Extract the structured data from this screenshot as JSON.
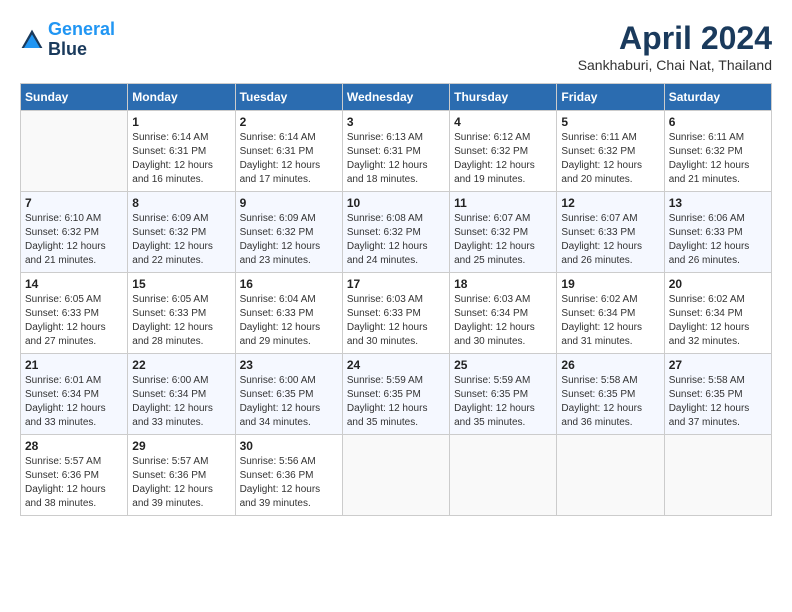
{
  "header": {
    "logo_line1": "General",
    "logo_line2": "Blue",
    "month_title": "April 2024",
    "location": "Sankhaburi, Chai Nat, Thailand"
  },
  "days_of_week": [
    "Sunday",
    "Monday",
    "Tuesday",
    "Wednesday",
    "Thursday",
    "Friday",
    "Saturday"
  ],
  "weeks": [
    [
      {
        "num": "",
        "sunrise": "",
        "sunset": "",
        "daylight": ""
      },
      {
        "num": "1",
        "sunrise": "Sunrise: 6:14 AM",
        "sunset": "Sunset: 6:31 PM",
        "daylight": "Daylight: 12 hours and 16 minutes."
      },
      {
        "num": "2",
        "sunrise": "Sunrise: 6:14 AM",
        "sunset": "Sunset: 6:31 PM",
        "daylight": "Daylight: 12 hours and 17 minutes."
      },
      {
        "num": "3",
        "sunrise": "Sunrise: 6:13 AM",
        "sunset": "Sunset: 6:31 PM",
        "daylight": "Daylight: 12 hours and 18 minutes."
      },
      {
        "num": "4",
        "sunrise": "Sunrise: 6:12 AM",
        "sunset": "Sunset: 6:32 PM",
        "daylight": "Daylight: 12 hours and 19 minutes."
      },
      {
        "num": "5",
        "sunrise": "Sunrise: 6:11 AM",
        "sunset": "Sunset: 6:32 PM",
        "daylight": "Daylight: 12 hours and 20 minutes."
      },
      {
        "num": "6",
        "sunrise": "Sunrise: 6:11 AM",
        "sunset": "Sunset: 6:32 PM",
        "daylight": "Daylight: 12 hours and 21 minutes."
      }
    ],
    [
      {
        "num": "7",
        "sunrise": "Sunrise: 6:10 AM",
        "sunset": "Sunset: 6:32 PM",
        "daylight": "Daylight: 12 hours and 21 minutes."
      },
      {
        "num": "8",
        "sunrise": "Sunrise: 6:09 AM",
        "sunset": "Sunset: 6:32 PM",
        "daylight": "Daylight: 12 hours and 22 minutes."
      },
      {
        "num": "9",
        "sunrise": "Sunrise: 6:09 AM",
        "sunset": "Sunset: 6:32 PM",
        "daylight": "Daylight: 12 hours and 23 minutes."
      },
      {
        "num": "10",
        "sunrise": "Sunrise: 6:08 AM",
        "sunset": "Sunset: 6:32 PM",
        "daylight": "Daylight: 12 hours and 24 minutes."
      },
      {
        "num": "11",
        "sunrise": "Sunrise: 6:07 AM",
        "sunset": "Sunset: 6:32 PM",
        "daylight": "Daylight: 12 hours and 25 minutes."
      },
      {
        "num": "12",
        "sunrise": "Sunrise: 6:07 AM",
        "sunset": "Sunset: 6:33 PM",
        "daylight": "Daylight: 12 hours and 26 minutes."
      },
      {
        "num": "13",
        "sunrise": "Sunrise: 6:06 AM",
        "sunset": "Sunset: 6:33 PM",
        "daylight": "Daylight: 12 hours and 26 minutes."
      }
    ],
    [
      {
        "num": "14",
        "sunrise": "Sunrise: 6:05 AM",
        "sunset": "Sunset: 6:33 PM",
        "daylight": "Daylight: 12 hours and 27 minutes."
      },
      {
        "num": "15",
        "sunrise": "Sunrise: 6:05 AM",
        "sunset": "Sunset: 6:33 PM",
        "daylight": "Daylight: 12 hours and 28 minutes."
      },
      {
        "num": "16",
        "sunrise": "Sunrise: 6:04 AM",
        "sunset": "Sunset: 6:33 PM",
        "daylight": "Daylight: 12 hours and 29 minutes."
      },
      {
        "num": "17",
        "sunrise": "Sunrise: 6:03 AM",
        "sunset": "Sunset: 6:33 PM",
        "daylight": "Daylight: 12 hours and 30 minutes."
      },
      {
        "num": "18",
        "sunrise": "Sunrise: 6:03 AM",
        "sunset": "Sunset: 6:34 PM",
        "daylight": "Daylight: 12 hours and 30 minutes."
      },
      {
        "num": "19",
        "sunrise": "Sunrise: 6:02 AM",
        "sunset": "Sunset: 6:34 PM",
        "daylight": "Daylight: 12 hours and 31 minutes."
      },
      {
        "num": "20",
        "sunrise": "Sunrise: 6:02 AM",
        "sunset": "Sunset: 6:34 PM",
        "daylight": "Daylight: 12 hours and 32 minutes."
      }
    ],
    [
      {
        "num": "21",
        "sunrise": "Sunrise: 6:01 AM",
        "sunset": "Sunset: 6:34 PM",
        "daylight": "Daylight: 12 hours and 33 minutes."
      },
      {
        "num": "22",
        "sunrise": "Sunrise: 6:00 AM",
        "sunset": "Sunset: 6:34 PM",
        "daylight": "Daylight: 12 hours and 33 minutes."
      },
      {
        "num": "23",
        "sunrise": "Sunrise: 6:00 AM",
        "sunset": "Sunset: 6:35 PM",
        "daylight": "Daylight: 12 hours and 34 minutes."
      },
      {
        "num": "24",
        "sunrise": "Sunrise: 5:59 AM",
        "sunset": "Sunset: 6:35 PM",
        "daylight": "Daylight: 12 hours and 35 minutes."
      },
      {
        "num": "25",
        "sunrise": "Sunrise: 5:59 AM",
        "sunset": "Sunset: 6:35 PM",
        "daylight": "Daylight: 12 hours and 35 minutes."
      },
      {
        "num": "26",
        "sunrise": "Sunrise: 5:58 AM",
        "sunset": "Sunset: 6:35 PM",
        "daylight": "Daylight: 12 hours and 36 minutes."
      },
      {
        "num": "27",
        "sunrise": "Sunrise: 5:58 AM",
        "sunset": "Sunset: 6:35 PM",
        "daylight": "Daylight: 12 hours and 37 minutes."
      }
    ],
    [
      {
        "num": "28",
        "sunrise": "Sunrise: 5:57 AM",
        "sunset": "Sunset: 6:36 PM",
        "daylight": "Daylight: 12 hours and 38 minutes."
      },
      {
        "num": "29",
        "sunrise": "Sunrise: 5:57 AM",
        "sunset": "Sunset: 6:36 PM",
        "daylight": "Daylight: 12 hours and 39 minutes."
      },
      {
        "num": "30",
        "sunrise": "Sunrise: 5:56 AM",
        "sunset": "Sunset: 6:36 PM",
        "daylight": "Daylight: 12 hours and 39 minutes."
      },
      {
        "num": "",
        "sunrise": "",
        "sunset": "",
        "daylight": ""
      },
      {
        "num": "",
        "sunrise": "",
        "sunset": "",
        "daylight": ""
      },
      {
        "num": "",
        "sunrise": "",
        "sunset": "",
        "daylight": ""
      },
      {
        "num": "",
        "sunrise": "",
        "sunset": "",
        "daylight": ""
      }
    ]
  ]
}
